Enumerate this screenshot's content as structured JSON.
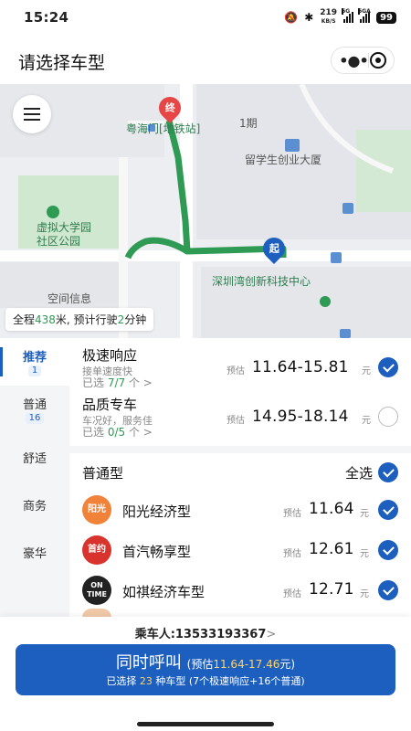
{
  "status_bar": {
    "time": "15:24",
    "speed_value": "219",
    "speed_unit": "KB/S",
    "signal1_tag": "5G",
    "signal2_tag": "5GA",
    "battery": "99"
  },
  "header": {
    "title": "请选择车型",
    "more_icon": "more-dots-icon",
    "close_icon": "target-close-icon"
  },
  "map": {
    "labels": {
      "metro": "粤海门[地铁站]",
      "phase": "1期",
      "student_building": "留学生创业大厦",
      "park_line1": "虚拟大学园",
      "park_line2": "社区公园",
      "space": "空间信息",
      "center": "深圳湾创新科技中心"
    },
    "end_marker": "终",
    "start_marker": "起",
    "summary": {
      "prefix": "全程",
      "distance": "438",
      "middle": "米, 预计行驶",
      "minutes": "2",
      "suffix": "分钟"
    },
    "colors": {
      "route": "#2e9a54",
      "start": "#1d5fbf",
      "end": "#e64646"
    }
  },
  "sidebar": {
    "items": [
      {
        "label": "推荐",
        "count": "1"
      },
      {
        "label": "普通",
        "count": "16"
      },
      {
        "label": "舒适"
      },
      {
        "label": "商务"
      },
      {
        "label": "豪华"
      }
    ]
  },
  "options": [
    {
      "name": "极速响应",
      "subtitle": "接单速度快",
      "selected_prefix": "已选",
      "selected_count": "7/7",
      "selected_suffix": "个 >",
      "est_label": "预估",
      "price": "11.64-15.81",
      "unit": "元",
      "checked": true
    },
    {
      "name": "品质专车",
      "subtitle": "车况好，服务佳",
      "selected_prefix": "已选",
      "selected_count": "0/5",
      "selected_suffix": "个 >",
      "est_label": "预估",
      "price": "14.95-18.14",
      "unit": "元",
      "checked": false
    }
  ],
  "section": {
    "title": "普通型",
    "select_all": "全选"
  },
  "brands": [
    {
      "logo": "阳光",
      "name": "阳光经济型",
      "est_label": "预估",
      "price": "11.64",
      "unit": "元",
      "color": "#f0823a"
    },
    {
      "logo": "首约",
      "name": "首汽畅享型",
      "est_label": "预估",
      "price": "12.61",
      "unit": "元",
      "color": "#d9332e"
    },
    {
      "logo": "ON TIME",
      "name": "如祺经济车型",
      "est_label": "预估",
      "price": "12.71",
      "unit": "元",
      "color": "#222222"
    }
  ],
  "footer": {
    "passenger_label": "乘车人:",
    "passenger_phone": "13533193367",
    "call_label": "同时呼叫",
    "call_est_prefix": "(预估",
    "call_est_range": "11.64-17.46",
    "call_est_suffix": "元)",
    "selected_prefix": "已选择",
    "selected_count": "23",
    "selected_mid": "种车型",
    "selected_detail": "(7个极速响应+16个普通)"
  },
  "accent_color": "#1d5fbf"
}
